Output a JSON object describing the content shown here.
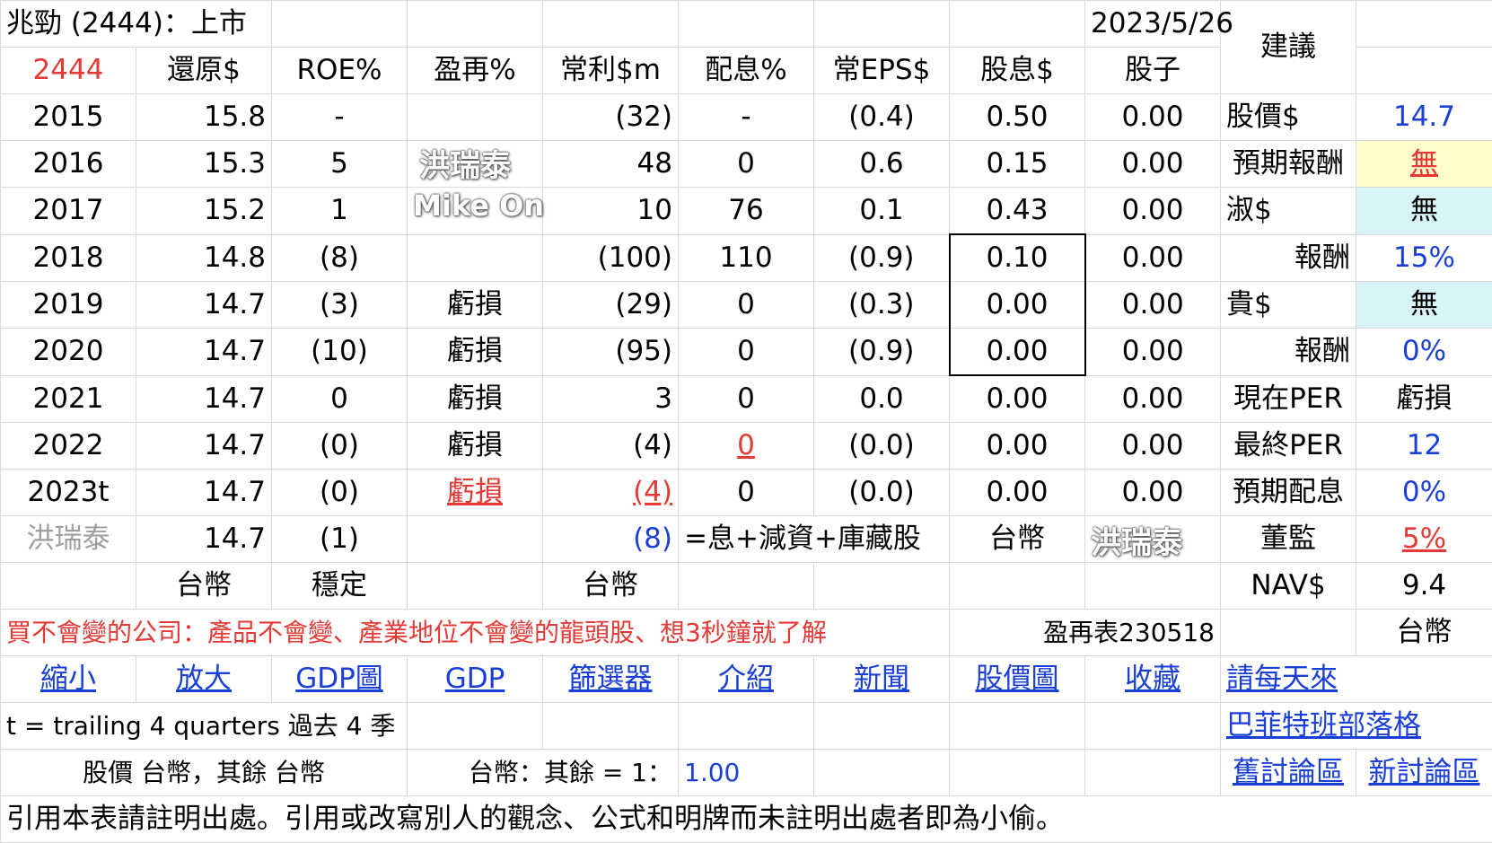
{
  "header": {
    "title": "兆勁 (2444)：上市",
    "date": "2023/5/26",
    "advice_label": "建議"
  },
  "columns": {
    "code": "2444",
    "c1": "還原$",
    "c2": "ROE%",
    "c3": "盈再%",
    "c4": "常利$m",
    "c5": "配息%",
    "c6": "常EPS$",
    "c7": "股息$",
    "c8": "股子"
  },
  "rows": [
    {
      "year": "2015",
      "restore": "15.8",
      "roe": "-",
      "reinv": "",
      "profit": "(32)",
      "payout": "-",
      "eps": "(0.4)",
      "div": "0.50",
      "stock": "0.00"
    },
    {
      "year": "2016",
      "restore": "15.3",
      "roe": "5",
      "reinv": "",
      "profit": "48",
      "payout": "0",
      "eps": "0.6",
      "div": "0.15",
      "stock": "0.00"
    },
    {
      "year": "2017",
      "restore": "15.2",
      "roe": "1",
      "reinv": "",
      "profit": "10",
      "payout": "76",
      "eps": "0.1",
      "div": "0.43",
      "stock": "0.00"
    },
    {
      "year": "2018",
      "restore": "14.8",
      "roe": "(8)",
      "reinv": "",
      "profit": "(100)",
      "payout": "110",
      "eps": "(0.9)",
      "div": "0.10",
      "stock": "0.00"
    },
    {
      "year": "2019",
      "restore": "14.7",
      "roe": "(3)",
      "reinv": "虧損",
      "profit": "(29)",
      "payout": "0",
      "eps": "(0.3)",
      "div": "0.00",
      "stock": "0.00"
    },
    {
      "year": "2020",
      "restore": "14.7",
      "roe": "(10)",
      "reinv": "虧損",
      "profit": "(95)",
      "payout": "0",
      "eps": "(0.9)",
      "div": "0.00",
      "stock": "0.00"
    },
    {
      "year": "2021",
      "restore": "14.7",
      "roe": "0",
      "reinv": "虧損",
      "profit": "3",
      "payout": "0",
      "eps": "0.0",
      "div": "0.00",
      "stock": "0.00"
    },
    {
      "year": "2022",
      "restore": "14.7",
      "roe": "(0)",
      "reinv": "虧損",
      "profit": "(4)",
      "payout": "0",
      "eps": "(0.0)",
      "div": "0.00",
      "stock": "0.00"
    },
    {
      "year": "2023t",
      "restore": "14.7",
      "roe": "(0)",
      "reinv": "虧損",
      "profit": "(4)",
      "payout": "0",
      "eps": "(0.0)",
      "div": "0.00",
      "stock": "0.00"
    }
  ],
  "avg_row": {
    "label": "洪瑞泰",
    "restore": "14.7",
    "roe": "(1)",
    "profit": "(8)",
    "note": "=息+減資+庫藏股",
    "div": "台幣"
  },
  "units_row": {
    "restore": "台幣",
    "roe": "穩定",
    "profit": "台幣"
  },
  "side": {
    "price_label": "股價$",
    "price": "14.7",
    "expected_label": "預期報酬",
    "expected": "無",
    "cheap_label": "淑$",
    "cheap": "無",
    "cheap_ret_label": "報酬",
    "cheap_ret": "15%",
    "exp_label": "貴$",
    "exp": "無",
    "exp_ret_label": "報酬",
    "exp_ret": "0%",
    "per_now_label": "現在PER",
    "per_now": "虧損",
    "per_final_label": "最終PER",
    "per_final": "12",
    "exp_div_label": "預期配息",
    "exp_div": "0%",
    "director_label": "董監",
    "director": "5%",
    "nav_label": "NAV$",
    "nav": "9.4",
    "currency": "台幣"
  },
  "motto": "買不會變的公司：產品不會變、產業地位不會變的龍頭股、想3秒鐘就了解",
  "table_ref": "盈再表230518",
  "links": [
    "縮小",
    "放大",
    "GDP圖",
    "GDP",
    "篩選器",
    "介紹",
    "新聞",
    "股價圖",
    "收藏",
    "請每天來"
  ],
  "side_links": {
    "blog": "巴菲特班部落格",
    "old_forum": "舊討論區",
    "new_forum": "新討論區"
  },
  "note_trailing": "t = trailing 4 quarters 過去 4 季",
  "currency_line": "股價 台幣，其餘 台幣",
  "rate_label": "台幣：其餘 = 1：",
  "rate_value": "1.00",
  "footer": "引用本表請註明出處。引用或改寫別人的觀念、公式和明牌而未註明出處者即為小偷。",
  "watermarks": {
    "name": "洪瑞泰",
    "mike": "Mike On"
  }
}
